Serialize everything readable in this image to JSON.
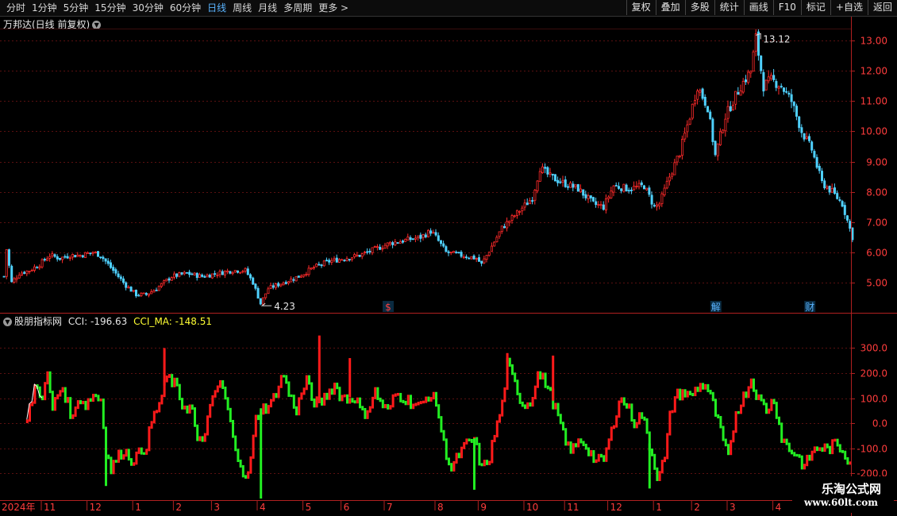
{
  "toolbar": {
    "periods": [
      "分时",
      "1分钟",
      "5分钟",
      "15分钟",
      "30分钟",
      "60分钟",
      "日线",
      "周线",
      "月线",
      "多周期",
      "更多 >"
    ],
    "active_period": "日线",
    "right_buttons": [
      "复权",
      "叠加",
      "多股",
      "统计",
      "画线",
      "F10",
      "标记",
      "+自选",
      "返回"
    ]
  },
  "price_panel": {
    "title": "万邦达(日线 前复权)",
    "high_label": "13.12",
    "low_label": "4.23",
    "markers": [
      {
        "text": "$",
        "color": "#ff4040",
        "day": 150
      },
      {
        "text": "解",
        "color": "#5ab4ff",
        "day": 279
      },
      {
        "text": "财",
        "color": "#5ab4ff",
        "day": 316
      }
    ]
  },
  "indicator_panel": {
    "name": "股朋指标网",
    "cci_label": "CCI: -196.63",
    "cci_ma_label": "CCI_MA: -148.51"
  },
  "axis": {
    "year_label": "2024年",
    "month_labels": [
      {
        "label": "11",
        "day": 15
      },
      {
        "label": "12",
        "day": 33
      },
      {
        "label": "1",
        "day": 51
      },
      {
        "label": "2",
        "day": 67
      },
      {
        "label": "3",
        "day": 82
      },
      {
        "label": "4",
        "day": 100
      },
      {
        "label": "5",
        "day": 118
      },
      {
        "label": "6",
        "day": 133
      },
      {
        "label": "7",
        "day": 150
      },
      {
        "label": "8",
        "day": 170
      },
      {
        "label": "9",
        "day": 187
      },
      {
        "label": "10",
        "day": 205
      },
      {
        "label": "11",
        "day": 221
      },
      {
        "label": "12",
        "day": 238
      },
      {
        "label": "1",
        "day": 256
      },
      {
        "label": "2",
        "day": 271
      },
      {
        "label": "3",
        "day": 285
      },
      {
        "label": "4",
        "day": 303
      },
      {
        "label": "5",
        "day": 322
      }
    ]
  },
  "watermark": {
    "line1": "乐淘公式网",
    "line2": "www.60lt.com"
  },
  "colors": {
    "up": "#ff2a2a",
    "down": "#4fd1ff",
    "cci_up": "#ff1a1a",
    "cci_down": "#22ee22",
    "grid": "#5a1010",
    "axis_text": "#ff3c3c",
    "cci_ma": "#ffffff",
    "cci_ma_label": "#ffff33"
  },
  "chart_data": [
    {
      "type": "candlestick",
      "y_ticks": [
        5.0,
        6.0,
        7.0,
        8.0,
        9.0,
        10.0,
        11.0,
        12.0,
        13.0
      ],
      "ylim": [
        4.05,
        13.4
      ],
      "keyframes": [
        [
          0,
          5.2
        ],
        [
          1,
          6.1
        ],
        [
          3,
          5.0
        ],
        [
          6,
          5.3
        ],
        [
          10,
          5.4
        ],
        [
          14,
          5.6
        ],
        [
          18,
          5.9
        ],
        [
          22,
          5.8
        ],
        [
          26,
          5.9
        ],
        [
          30,
          5.9
        ],
        [
          35,
          6.0
        ],
        [
          38,
          5.9
        ],
        [
          44,
          5.3
        ],
        [
          48,
          4.9
        ],
        [
          52,
          4.6
        ],
        [
          56,
          4.6
        ],
        [
          60,
          4.8
        ],
        [
          66,
          5.2
        ],
        [
          72,
          5.3
        ],
        [
          78,
          5.2
        ],
        [
          84,
          5.3
        ],
        [
          90,
          5.4
        ],
        [
          95,
          5.4
        ],
        [
          98,
          5.0
        ],
        [
          101,
          4.3
        ],
        [
          104,
          4.8
        ],
        [
          110,
          5.0
        ],
        [
          116,
          5.2
        ],
        [
          122,
          5.5
        ],
        [
          128,
          5.7
        ],
        [
          134,
          5.8
        ],
        [
          140,
          5.9
        ],
        [
          146,
          6.1
        ],
        [
          152,
          6.3
        ],
        [
          158,
          6.4
        ],
        [
          164,
          6.5
        ],
        [
          168,
          6.7
        ],
        [
          170,
          6.5
        ],
        [
          174,
          6.0
        ],
        [
          180,
          5.9
        ],
        [
          186,
          5.8
        ],
        [
          188,
          5.6
        ],
        [
          192,
          6.2
        ],
        [
          196,
          6.8
        ],
        [
          202,
          7.3
        ],
        [
          208,
          7.8
        ],
        [
          211,
          8.8
        ],
        [
          215,
          8.5
        ],
        [
          220,
          8.3
        ],
        [
          226,
          8.1
        ],
        [
          232,
          7.6
        ],
        [
          236,
          7.5
        ],
        [
          240,
          8.2
        ],
        [
          246,
          8.1
        ],
        [
          252,
          8.2
        ],
        [
          256,
          7.5
        ],
        [
          258,
          7.6
        ],
        [
          262,
          8.5
        ],
        [
          266,
          9.3
        ],
        [
          270,
          10.5
        ],
        [
          273,
          11.5
        ],
        [
          277,
          10.8
        ],
        [
          280,
          9.2
        ],
        [
          284,
          10.5
        ],
        [
          290,
          11.5
        ],
        [
          294,
          12.0
        ],
        [
          296,
          13.1
        ],
        [
          299,
          11.5
        ],
        [
          302,
          11.7
        ],
        [
          306,
          11.5
        ],
        [
          310,
          11.0
        ],
        [
          314,
          10.0
        ],
        [
          318,
          9.4
        ],
        [
          322,
          8.3
        ],
        [
          326,
          8.0
        ],
        [
          330,
          7.6
        ],
        [
          334,
          6.5
        ]
      ]
    },
    {
      "type": "cci_oscillator",
      "y_ticks": [
        300.0,
        200.0,
        100.0,
        0.0,
        -100.0,
        -200.0
      ],
      "ylim": [
        -300,
        390
      ],
      "keyframes": [
        [
          9,
          10
        ],
        [
          12,
          150
        ],
        [
          15,
          120
        ],
        [
          17,
          190
        ],
        [
          19,
          60
        ],
        [
          21,
          120
        ],
        [
          23,
          150
        ],
        [
          25,
          80
        ],
        [
          27,
          20
        ],
        [
          29,
          110
        ],
        [
          32,
          80
        ],
        [
          35,
          120
        ],
        [
          38,
          100
        ],
        [
          40,
          -100
        ],
        [
          42,
          -180
        ],
        [
          44,
          -140
        ],
        [
          47,
          -100
        ],
        [
          50,
          -140
        ],
        [
          53,
          -120
        ],
        [
          56,
          -80
        ],
        [
          58,
          10
        ],
        [
          60,
          60
        ],
        [
          62,
          110
        ],
        [
          64,
          190
        ],
        [
          67,
          160
        ],
        [
          70,
          80
        ],
        [
          74,
          60
        ],
        [
          76,
          -80
        ],
        [
          78,
          -60
        ],
        [
          80,
          20
        ],
        [
          83,
          130
        ],
        [
          85,
          170
        ],
        [
          88,
          60
        ],
        [
          90,
          -60
        ],
        [
          93,
          -150
        ],
        [
          95,
          -230
        ],
        [
          97,
          -140
        ],
        [
          99,
          20
        ],
        [
          101,
          60
        ],
        [
          105,
          80
        ],
        [
          108,
          160
        ],
        [
          110,
          200
        ],
        [
          112,
          120
        ],
        [
          115,
          60
        ],
        [
          119,
          180
        ],
        [
          121,
          100
        ],
        [
          124,
          80
        ],
        [
          127,
          120
        ],
        [
          130,
          160
        ],
        [
          132,
          120
        ],
        [
          135,
          100
        ],
        [
          138,
          110
        ],
        [
          141,
          40
        ],
        [
          143,
          60
        ],
        [
          146,
          130
        ],
        [
          148,
          90
        ],
        [
          151,
          50
        ],
        [
          154,
          120
        ],
        [
          157,
          110
        ],
        [
          160,
          90
        ],
        [
          164,
          70
        ],
        [
          167,
          120
        ],
        [
          170,
          90
        ],
        [
          173,
          -80
        ],
        [
          176,
          -180
        ],
        [
          179,
          -120
        ],
        [
          182,
          -80
        ],
        [
          185,
          -60
        ],
        [
          188,
          -180
        ],
        [
          191,
          -130
        ],
        [
          193,
          -40
        ],
        [
          196,
          80
        ],
        [
          198,
          240
        ],
        [
          201,
          160
        ],
        [
          204,
          80
        ],
        [
          207,
          90
        ],
        [
          210,
          200
        ],
        [
          213,
          170
        ],
        [
          216,
          90
        ],
        [
          218,
          30
        ],
        [
          221,
          -80
        ],
        [
          224,
          -100
        ],
        [
          227,
          -60
        ],
        [
          230,
          -100
        ],
        [
          233,
          -150
        ],
        [
          236,
          -140
        ],
        [
          239,
          -30
        ],
        [
          242,
          100
        ],
        [
          245,
          80
        ],
        [
          248,
          10
        ],
        [
          251,
          40
        ],
        [
          254,
          -80
        ],
        [
          257,
          -200
        ],
        [
          260,
          -140
        ],
        [
          262,
          30
        ],
        [
          264,
          110
        ],
        [
          267,
          130
        ],
        [
          270,
          110
        ],
        [
          273,
          150
        ],
        [
          276,
          160
        ],
        [
          279,
          80
        ],
        [
          282,
          -30
        ],
        [
          285,
          -140
        ],
        [
          288,
          50
        ],
        [
          291,
          110
        ],
        [
          294,
          180
        ],
        [
          297,
          100
        ],
        [
          300,
          60
        ],
        [
          303,
          100
        ],
        [
          306,
          -50
        ],
        [
          309,
          -100
        ],
        [
          312,
          -120
        ],
        [
          315,
          -170
        ],
        [
          318,
          -110
        ],
        [
          321,
          -90
        ],
        [
          324,
          -100
        ],
        [
          327,
          -80
        ],
        [
          330,
          -100
        ],
        [
          333,
          -150
        ]
      ],
      "current_cci": -196.63,
      "current_cci_ma": -148.51
    }
  ]
}
